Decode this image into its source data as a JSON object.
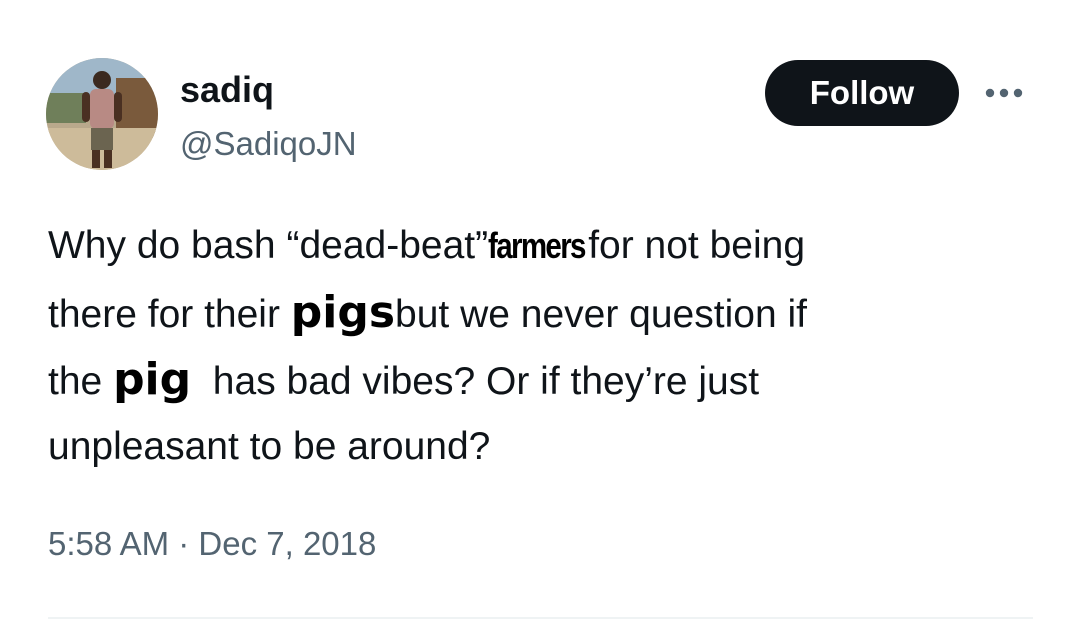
{
  "author": {
    "display_name": "sadiq",
    "handle": "@SadiqoJN"
  },
  "actions": {
    "follow_label": "Follow",
    "more_icon": "more-horizontal-icon"
  },
  "tweet": {
    "lines": [
      [
        "Why do bash “dead-beat”",
        "farmers",
        "for not being"
      ],
      [
        "there for their ",
        "pigs",
        "but we never question if"
      ],
      [
        "the ",
        "pig",
        "  has bad vibes? Or if they’re just"
      ],
      [
        "unpleasant to be around?"
      ]
    ]
  },
  "timestamp": "5:58 AM · Dec 7, 2018",
  "colors": {
    "text": "#0f1419",
    "secondary": "#536471",
    "button_bg": "#0f1419",
    "button_text": "#ffffff",
    "divider": "#eff3f4"
  }
}
